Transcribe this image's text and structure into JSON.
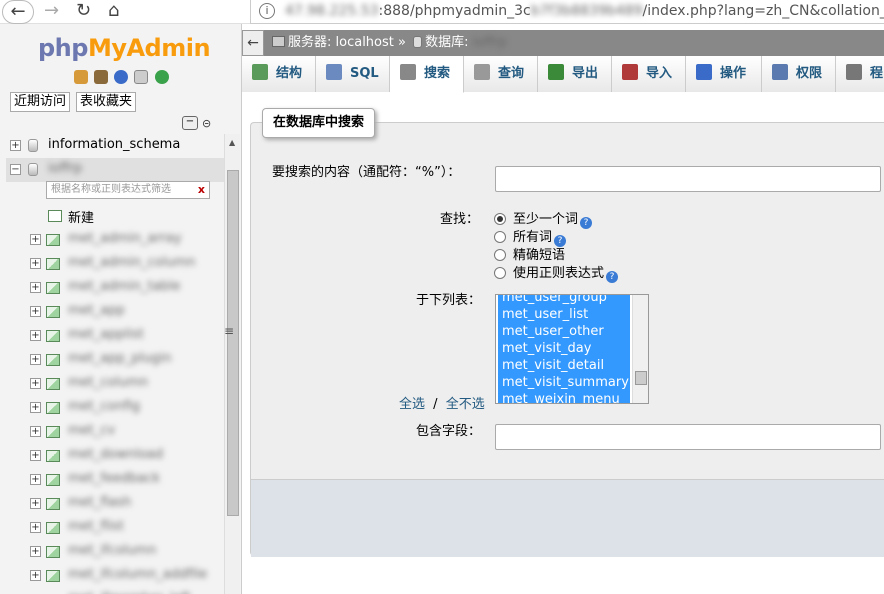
{
  "browser": {
    "url_host": "47.98.225.53",
    "url_rest": ":888/phpmyadmin_3c",
    "url_hidden": "b7f3b8839b489",
    "url_tail": "/index.php?lang=zh_CN&collation_conn"
  },
  "logo": {
    "part1": "php",
    "part2": "MyAdmin"
  },
  "left": {
    "recent_label": "近期访问",
    "favorite_label": "表收藏夹",
    "tree": [
      {
        "label": "information_schema"
      },
      {
        "label": "ioffrp"
      }
    ],
    "filter_placeholder": "根据名称或正则表达式筛选",
    "filter_clear": "x",
    "new_label": "新建",
    "tables": [
      "met_admin_array",
      "met_admin_column",
      "met_admin_table",
      "met_app",
      "met_applist",
      "met_app_plugin",
      "met_column",
      "met_config",
      "met_cv",
      "met_download",
      "met_feedback",
      "met_flash",
      "met_flist",
      "met_ifcolumn",
      "met_ifcolumn_addfile",
      "met_ifmember_left"
    ]
  },
  "breadcrumb": {
    "server_label": "服务器: localhost",
    "sep": "»",
    "db_label": "数据库:",
    "db_name": "ioffrp"
  },
  "tabs": [
    {
      "label": "结构",
      "color": "#5a9a5a"
    },
    {
      "label": "SQL",
      "color": "#6a8ac0"
    },
    {
      "label": "搜索",
      "color": "#888888"
    },
    {
      "label": "查询",
      "color": "#999999"
    },
    {
      "label": "导出",
      "color": "#3a8a3a"
    },
    {
      "label": "导入",
      "color": "#b03a3a"
    },
    {
      "label": "操作",
      "color": "#3a6bc8"
    },
    {
      "label": "权限",
      "color": "#5a7ab0"
    },
    {
      "label": "程",
      "color": "#777777"
    }
  ],
  "search": {
    "legend": "在数据库中搜索",
    "content_label": "要搜索的内容（通配符：“%”）：",
    "find_label": "查找：",
    "options": [
      {
        "label": "至少一个词",
        "checked": true
      },
      {
        "label": "所有词",
        "checked": false
      },
      {
        "label": "精确短语",
        "checked": false
      },
      {
        "label": "使用正则表达式",
        "checked": false
      }
    ],
    "in_tables_label": "于下列表：",
    "table_list": [
      "met_user_group",
      "met_user_list",
      "met_user_other",
      "met_visit_day",
      "met_visit_detail",
      "met_visit_summary",
      "met_weixin_menu"
    ],
    "select_all": "全选",
    "divider": "/",
    "deselect_all": "全不选",
    "column_label": "包含字段："
  }
}
